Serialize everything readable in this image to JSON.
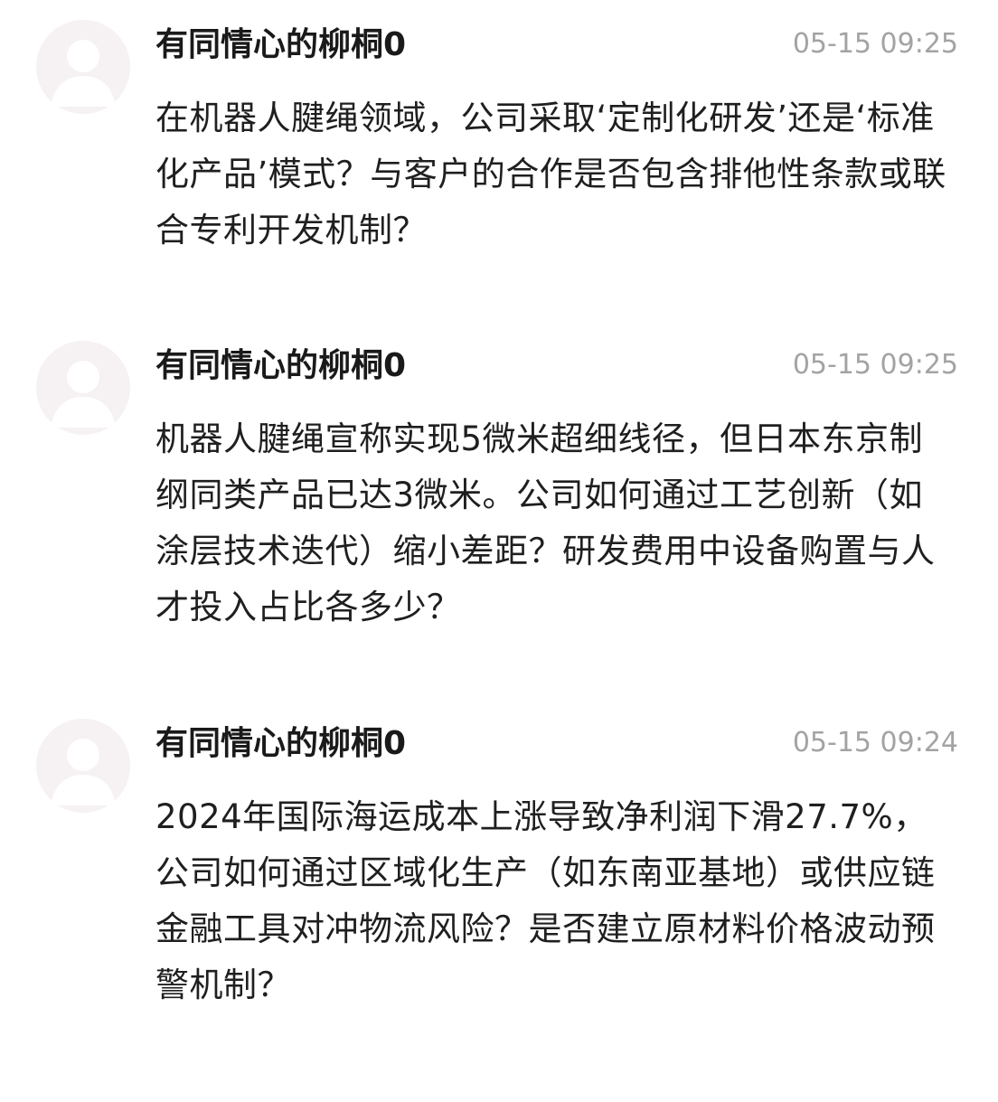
{
  "comments": [
    {
      "avatar_icon": "default-user-avatar-icon",
      "username": "有同情心的柳桐0",
      "timestamp": "05-15 09:25",
      "content": "在机器人腱绳领域，公司采取‘定制化研发’还是‘标准化产品’模式？与客户的合作是否包含排他性条款或联合专利开发机制？"
    },
    {
      "avatar_icon": "default-user-avatar-icon",
      "username": "有同情心的柳桐0",
      "timestamp": "05-15 09:25",
      "content": "机器人腱绳宣称实现5微米超细线径，但日本东京制纲同类产品已达3微米。公司如何通过工艺创新（如涂层技术迭代）缩小差距？研发费用中设备购置与人才投入占比各多少？"
    },
    {
      "avatar_icon": "default-user-avatar-icon",
      "username": "有同情心的柳桐0",
      "timestamp": "05-15 09:24",
      "content": "2024年国际海运成本上涨导致净利润下滑27.7%，公司如何通过区域化生产（如东南亚基地）或供应链金融工具对冲物流风险？是否建立原材料价格波动预警机制？"
    }
  ],
  "colors": {
    "avatar_bg": "#f6f1f3",
    "avatar_figure": "#ffffff",
    "username": "#1a1a1a",
    "timestamp": "#a3a3a3",
    "content": "#1f1f1f"
  }
}
